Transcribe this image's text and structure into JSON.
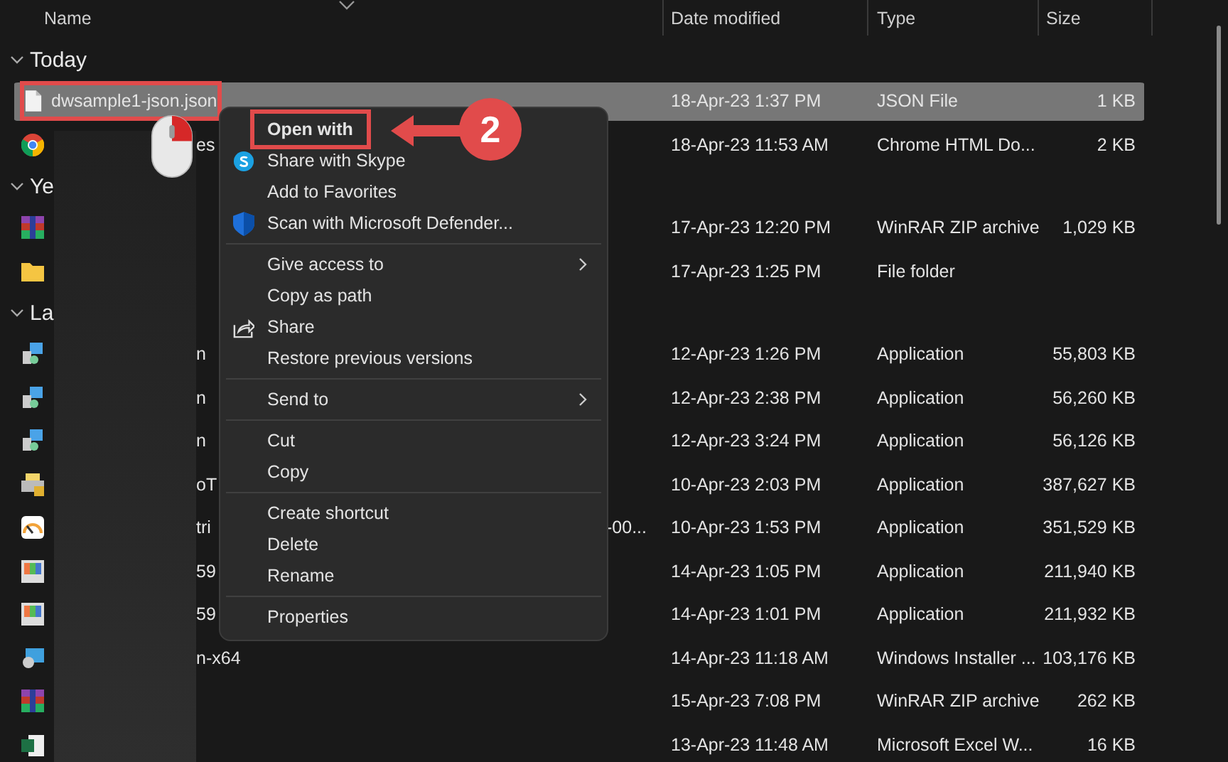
{
  "columns": [
    {
      "label": "Name"
    },
    {
      "label": "Date modified"
    },
    {
      "label": "Type"
    },
    {
      "label": "Size"
    }
  ],
  "groups": [
    {
      "label": "Today",
      "expanded": true,
      "rows": [
        {
          "kind": "json",
          "name": "dwsample1-json.json",
          "name_hidden": false,
          "selected": true,
          "highlighted": true,
          "date": "18-Apr-23 1:37 PM",
          "type": "JSON File",
          "size": "1 KB"
        },
        {
          "kind": "chrome",
          "name": "es",
          "name_hidden": true,
          "selected": false,
          "highlighted": false,
          "date": "18-Apr-23 11:53 AM",
          "type": "Chrome HTML Do...",
          "size": "2 KB"
        }
      ]
    },
    {
      "label": "Ye",
      "expanded": true,
      "rows": [
        {
          "kind": "winrar",
          "selected": false,
          "highlighted": false,
          "date": "17-Apr-23 12:20 PM",
          "type": "WinRAR ZIP archive",
          "size": "1,029 KB"
        },
        {
          "kind": "folder",
          "selected": false,
          "highlighted": false,
          "date": "17-Apr-23 1:25 PM",
          "type": "File folder"
        }
      ]
    },
    {
      "label": "La",
      "expanded": true,
      "rows": [
        {
          "kind": "installer",
          "name": "n",
          "name_hidden": true,
          "selected": false,
          "highlighted": false,
          "date": "12-Apr-23 1:26 PM",
          "type": "Application",
          "size": "55,803 KB"
        },
        {
          "kind": "installer",
          "name": "n",
          "name_hidden": true,
          "selected": false,
          "highlighted": false,
          "date": "12-Apr-23 2:38 PM",
          "type": "Application",
          "size": "56,260 KB"
        },
        {
          "kind": "installer",
          "name": "n",
          "name_hidden": true,
          "selected": false,
          "highlighted": false,
          "date": "12-Apr-23 3:24 PM",
          "type": "Application",
          "size": "56,126 KB"
        },
        {
          "kind": "printer",
          "name": "oT",
          "name_hidden": true,
          "selected": false,
          "highlighted": false,
          "date": "10-Apr-23 2:03 PM",
          "type": "Application",
          "size": "387,627 KB"
        },
        {
          "kind": "gauge",
          "name": "tri",
          "name_tail": "-00...",
          "name_hidden": true,
          "selected": false,
          "highlighted": false,
          "date": "10-Apr-23 1:53 PM",
          "type": "Application",
          "size": "351,529 KB"
        },
        {
          "kind": "tv",
          "name": "59",
          "name_hidden": true,
          "selected": false,
          "highlighted": false,
          "date": "14-Apr-23 1:05 PM",
          "type": "Application",
          "size": "211,940 KB"
        },
        {
          "kind": "tv",
          "name": "59",
          "name_hidden": true,
          "selected": false,
          "highlighted": false,
          "date": "14-Apr-23 1:01 PM",
          "type": "Application",
          "size": "211,932 KB"
        },
        {
          "kind": "msi",
          "name": "n-x64",
          "name_hidden": true,
          "selected": false,
          "highlighted": false,
          "date": "14-Apr-23 11:18 AM",
          "type": "Windows Installer ...",
          "size": "103,176 KB"
        },
        {
          "kind": "winrar",
          "selected": false,
          "highlighted": false,
          "date": "15-Apr-23 7:08 PM",
          "type": "WinRAR ZIP archive",
          "size": "262 KB"
        },
        {
          "kind": "excel",
          "selected": false,
          "highlighted": false,
          "date": "13-Apr-23 11:48 AM",
          "type": "Microsoft Excel W...",
          "size": "16 KB"
        }
      ]
    }
  ],
  "context_menu": {
    "items": [
      {
        "kind": "item",
        "label": "Open with",
        "default": true,
        "highlighted": true
      },
      {
        "kind": "skype-item",
        "label": "Share with Skype",
        "default": false,
        "highlighted": false
      },
      {
        "kind": "item",
        "label": "Add to Favorites",
        "default": false,
        "highlighted": false
      },
      {
        "kind": "shield-item",
        "label": "Scan with Microsoft Defender...",
        "default": false,
        "highlighted": false
      },
      {
        "kind": "separator"
      },
      {
        "kind": "submenu",
        "label": "Give access to",
        "default": false,
        "highlighted": false
      },
      {
        "kind": "item",
        "label": "Copy as path",
        "default": false,
        "highlighted": false
      },
      {
        "kind": "share-item",
        "label": "Share",
        "default": false,
        "highlighted": false
      },
      {
        "kind": "item",
        "label": "Restore previous versions",
        "default": false,
        "highlighted": false
      },
      {
        "kind": "separator"
      },
      {
        "kind": "submenu",
        "label": "Send to",
        "default": false,
        "highlighted": false
      },
      {
        "kind": "separator"
      },
      {
        "kind": "item",
        "label": "Cut",
        "default": false,
        "highlighted": false
      },
      {
        "kind": "item",
        "label": "Copy",
        "default": false,
        "highlighted": false
      },
      {
        "kind": "separator"
      },
      {
        "kind": "item",
        "label": "Create shortcut",
        "default": false,
        "highlighted": false
      },
      {
        "kind": "item",
        "label": "Delete",
        "default": false,
        "highlighted": false
      },
      {
        "kind": "item",
        "label": "Rename",
        "default": false,
        "highlighted": false
      },
      {
        "kind": "separator"
      },
      {
        "kind": "item",
        "label": "Properties",
        "default": false,
        "highlighted": false
      }
    ]
  },
  "step_badge": "2"
}
